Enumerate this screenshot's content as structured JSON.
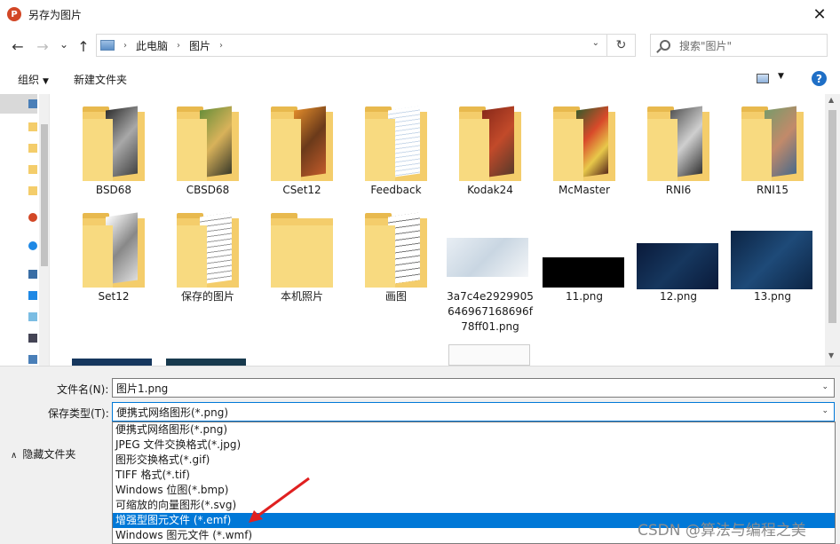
{
  "window": {
    "title": "另存为图片",
    "app_icon_letter": "P",
    "close_glyph": "✕"
  },
  "nav": {
    "back_glyph": "←",
    "forward_glyph": "→",
    "recent_glyph": "⌄",
    "up_glyph": "↑",
    "breadcrumbs": [
      "此电脑",
      "图片"
    ],
    "separator": "›",
    "refresh_glyph": "↻",
    "dropdown_glyph": "⌄",
    "search_placeholder": "搜索\"图片\""
  },
  "toolbar": {
    "organize_label": "组织",
    "organize_caret": "▼",
    "new_folder_label": "新建文件夹",
    "view_caret": "▼",
    "help_glyph": "?"
  },
  "files": [
    {
      "name": "BSD68",
      "kind": "folder"
    },
    {
      "name": "CBSD68",
      "kind": "folder"
    },
    {
      "name": "CSet12",
      "kind": "folder"
    },
    {
      "name": "Feedback",
      "kind": "folder"
    },
    {
      "name": "Kodak24",
      "kind": "folder"
    },
    {
      "name": "McMaster",
      "kind": "folder"
    },
    {
      "name": "RNI6",
      "kind": "folder"
    },
    {
      "name": "RNI15",
      "kind": "folder"
    },
    {
      "name": "Set12",
      "kind": "folder"
    },
    {
      "name": "保存的图片",
      "kind": "folder"
    },
    {
      "name": "本机照片",
      "kind": "folder"
    },
    {
      "name": "画图",
      "kind": "folder"
    },
    {
      "name": "3a7c4e2929905646967168696f78ff01.png",
      "label_lines": [
        "3a7c4e2929905",
        "646967168696f",
        "78ff01.png"
      ],
      "kind": "image"
    },
    {
      "name": "11.png",
      "kind": "image"
    },
    {
      "name": "12.png",
      "kind": "image"
    },
    {
      "name": "13.png",
      "kind": "image"
    }
  ],
  "form": {
    "filename_label": "文件名(N):",
    "filename_value": "图片1.png",
    "filetype_label": "保存类型(T):",
    "filetype_value": "便携式网络图形(*.png)",
    "caret": "⌄",
    "hide_folders_label": "隐藏文件夹",
    "hide_folders_chevron": "∧"
  },
  "filetype_options": [
    "便携式网络图形(*.png)",
    "JPEG 文件交换格式(*.jpg)",
    "图形交换格式(*.gif)",
    "TIFF 格式(*.tif)",
    "Windows 位图(*.bmp)",
    "可缩放的向量图形(*.svg)",
    "增强型图元文件 (*.emf)",
    "Windows 图元文件 (*.wmf)"
  ],
  "selected_option_index": 6,
  "watermark": "CSDN @算法与编程之美",
  "colors": {
    "accent": "#0078d7",
    "folder": "#f4cd6b",
    "arrow": "#e02020"
  }
}
